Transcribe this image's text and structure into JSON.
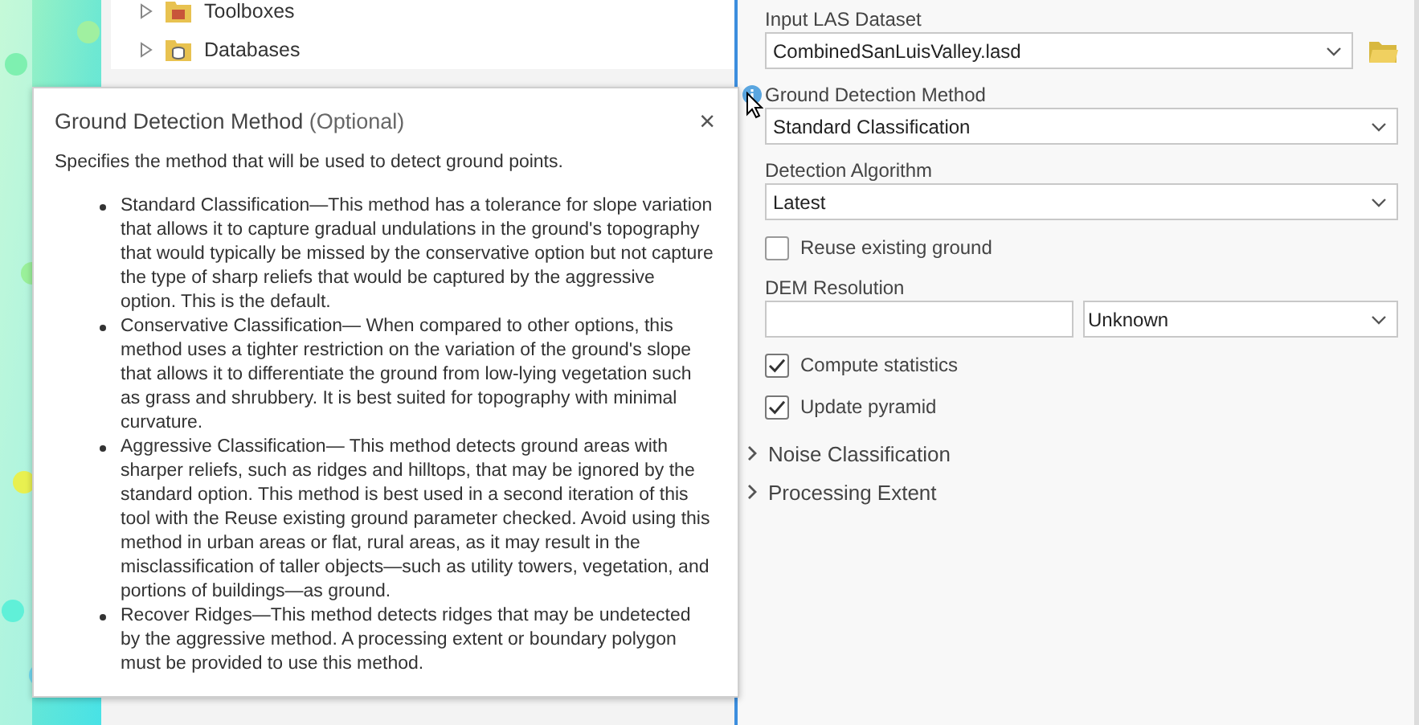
{
  "catalog": {
    "items": [
      {
        "label": "Toolboxes",
        "kind": "toolbox",
        "expanded": false
      },
      {
        "label": "Databases",
        "kind": "database",
        "expanded": false
      }
    ]
  },
  "parameters": [
    {
      "kind": "dropdown",
      "label": "Input LAS Dataset",
      "value": "CombinedSanLuisValley.lasd",
      "browse": true,
      "info": false
    },
    {
      "kind": "dropdown",
      "label": "Ground Detection Method",
      "value": "Standard Classification",
      "browse": false,
      "info": true
    },
    {
      "kind": "dropdown",
      "label": "Detection Algorithm",
      "value": "Latest",
      "browse": false,
      "info": false
    },
    {
      "kind": "checkbox",
      "label": "Reuse existing ground",
      "checked": false
    },
    {
      "kind": "linear_unit",
      "label": "DEM Resolution",
      "unit": "Unknown"
    },
    {
      "kind": "checkbox",
      "label": "Compute statistics",
      "checked": true
    },
    {
      "kind": "checkbox",
      "label": "Update pyramid",
      "checked": true
    },
    {
      "kind": "group",
      "label": "Noise Classification",
      "expanded": false
    },
    {
      "kind": "group",
      "label": "Processing Extent",
      "expanded": false
    }
  ],
  "popup": {
    "title": "Ground Detection Method",
    "qualifier": "(Optional)",
    "close": "×",
    "summary": "Specifies the method that will be used to detect ground points.",
    "bullets": [
      "Standard Classification—This method has a tolerance for slope variation that allows it to capture gradual undulations in the ground's topography that would typically be missed by the conservative option but not capture the type of sharp reliefs that would be captured by the aggressive option. This is the default.",
      "Conservative Classification— When compared to other options, this method uses a tighter restriction on the variation of the ground's slope that allows it to differentiate the ground from low-lying vegetation such as grass and shrubbery. It is best suited for topography with minimal curvature.",
      "Aggressive Classification— This method detects ground areas with sharper reliefs, such as ridges and hilltops, that may be ignored by the standard option. This method is best used in a second iteration of this tool with the Reuse existing ground parameter checked. Avoid using this method in urban areas or flat, rural areas, as it may result in the misclassification of taller objects—such as utility towers, vegetation, and portions of buildings—as ground.",
      "Recover Ridges—This method detects ridges that may be undetected by the aggressive method. A processing extent or boundary polygon must be provided to use this method."
    ]
  }
}
